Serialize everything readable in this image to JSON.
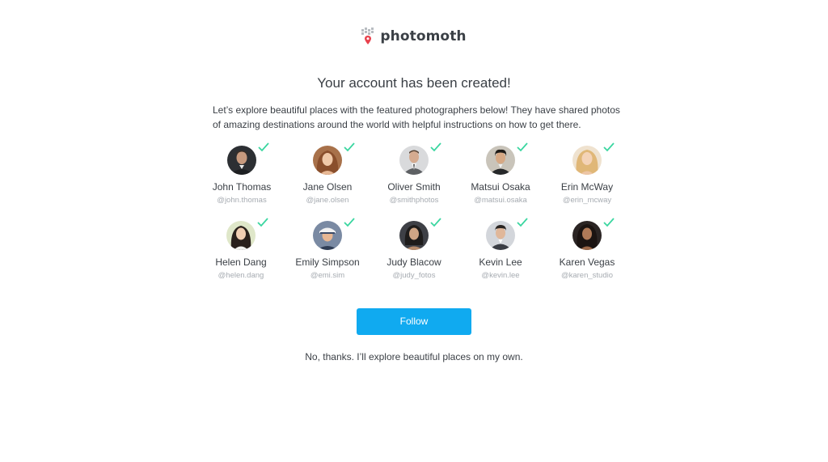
{
  "brand": {
    "name": "photomoth",
    "pin_color": "#e8414d",
    "dots_color": "#b8bcc1"
  },
  "title": "Your account has been created!",
  "intro": "Let’s explore beautiful places with the featured photographers below! They have shared photos of amazing destinations around the world with helpful instructions on how to get there.",
  "accent": "#10aaf0",
  "check_color": "#3ad6a0",
  "photographers": [
    {
      "name": "John Thomas",
      "handle": "@john.thomas",
      "selected": true
    },
    {
      "name": "Jane Olsen",
      "handle": "@jane.olsen",
      "selected": true
    },
    {
      "name": "Oliver Smith",
      "handle": "@smithphotos",
      "selected": true
    },
    {
      "name": "Matsui Osaka",
      "handle": "@matsui.osaka",
      "selected": true
    },
    {
      "name": "Erin McWay",
      "handle": "@erin_mcway",
      "selected": true
    },
    {
      "name": "Helen Dang",
      "handle": "@helen.dang",
      "selected": true
    },
    {
      "name": "Emily Simpson",
      "handle": "@emi.sim",
      "selected": true
    },
    {
      "name": "Judy Blacow",
      "handle": "@judy_fotos",
      "selected": true
    },
    {
      "name": "Kevin Lee",
      "handle": "@kevin.lee",
      "selected": true
    },
    {
      "name": "Karen Vegas",
      "handle": "@karen_studio",
      "selected": true
    }
  ],
  "follow_label": "Follow",
  "decline_label": "No, thanks. I’ll explore beautiful places on my own."
}
